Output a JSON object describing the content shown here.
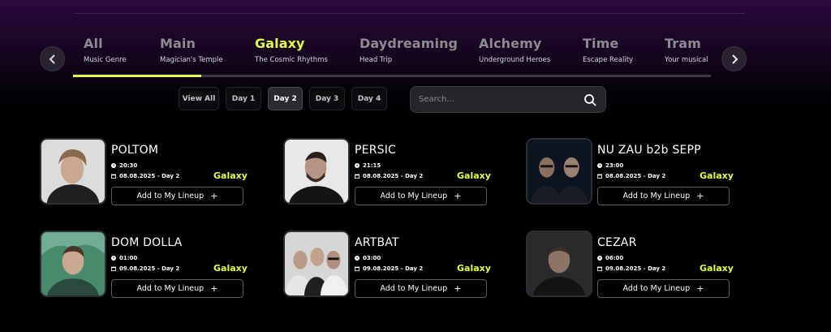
{
  "filters": {
    "tabs": [
      {
        "title": "All",
        "subtitle": "Music Genre"
      },
      {
        "title": "Main",
        "subtitle": "Magician's Temple"
      },
      {
        "title": "Galaxy",
        "subtitle": "The Cosmic Rhythms"
      },
      {
        "title": "Daydreaming",
        "subtitle": "Head Trip"
      },
      {
        "title": "Alchemy",
        "subtitle": "Underground Heroes"
      },
      {
        "title": "Time",
        "subtitle": "Escape Reality"
      },
      {
        "title": "Tram",
        "subtitle": "Your musical ..."
      }
    ],
    "active_tab": "Galaxy",
    "days": [
      "View All",
      "Day 1",
      "Day 2",
      "Day 3",
      "Day 4"
    ],
    "active_day": "Day 2",
    "search_placeholder": "Search..."
  },
  "colors": {
    "accent": "#e1ff48",
    "background": "#000000",
    "header_gradient": "#2a0a3c"
  },
  "icons": {
    "prev": "chevron-left-icon",
    "next": "chevron-right-icon",
    "search": "search-icon",
    "time": "clock-icon",
    "date": "calendar-icon",
    "add": "plus-icon"
  },
  "artists": [
    {
      "name": "POLTOM",
      "time": "20:30",
      "date": "08.08.2025 - Day 2",
      "stage": "Galaxy",
      "button": "Add to My Lineup"
    },
    {
      "name": "PERSIC",
      "time": "21:15",
      "date": "08.08.2025 - Day 2",
      "stage": "Galaxy",
      "button": "Add to My Lineup"
    },
    {
      "name": "NU ZAU b2b SEPP",
      "time": "23:00",
      "date": "08.08.2025 - Day 2",
      "stage": "Galaxy",
      "button": "Add to My Lineup"
    },
    {
      "name": "DOM DOLLA",
      "time": "01:00",
      "date": "09.08.2025 - Day 2",
      "stage": "Galaxy",
      "button": "Add to My Lineup"
    },
    {
      "name": "ARTBAT",
      "time": "03:00",
      "date": "09.08.2025 - Day 2",
      "stage": "Galaxy",
      "button": "Add to My Lineup"
    },
    {
      "name": "CEZAR",
      "time": "06:00",
      "date": "09.08.2025 - Day 2",
      "stage": "Galaxy",
      "button": "Add to My Lineup"
    }
  ]
}
